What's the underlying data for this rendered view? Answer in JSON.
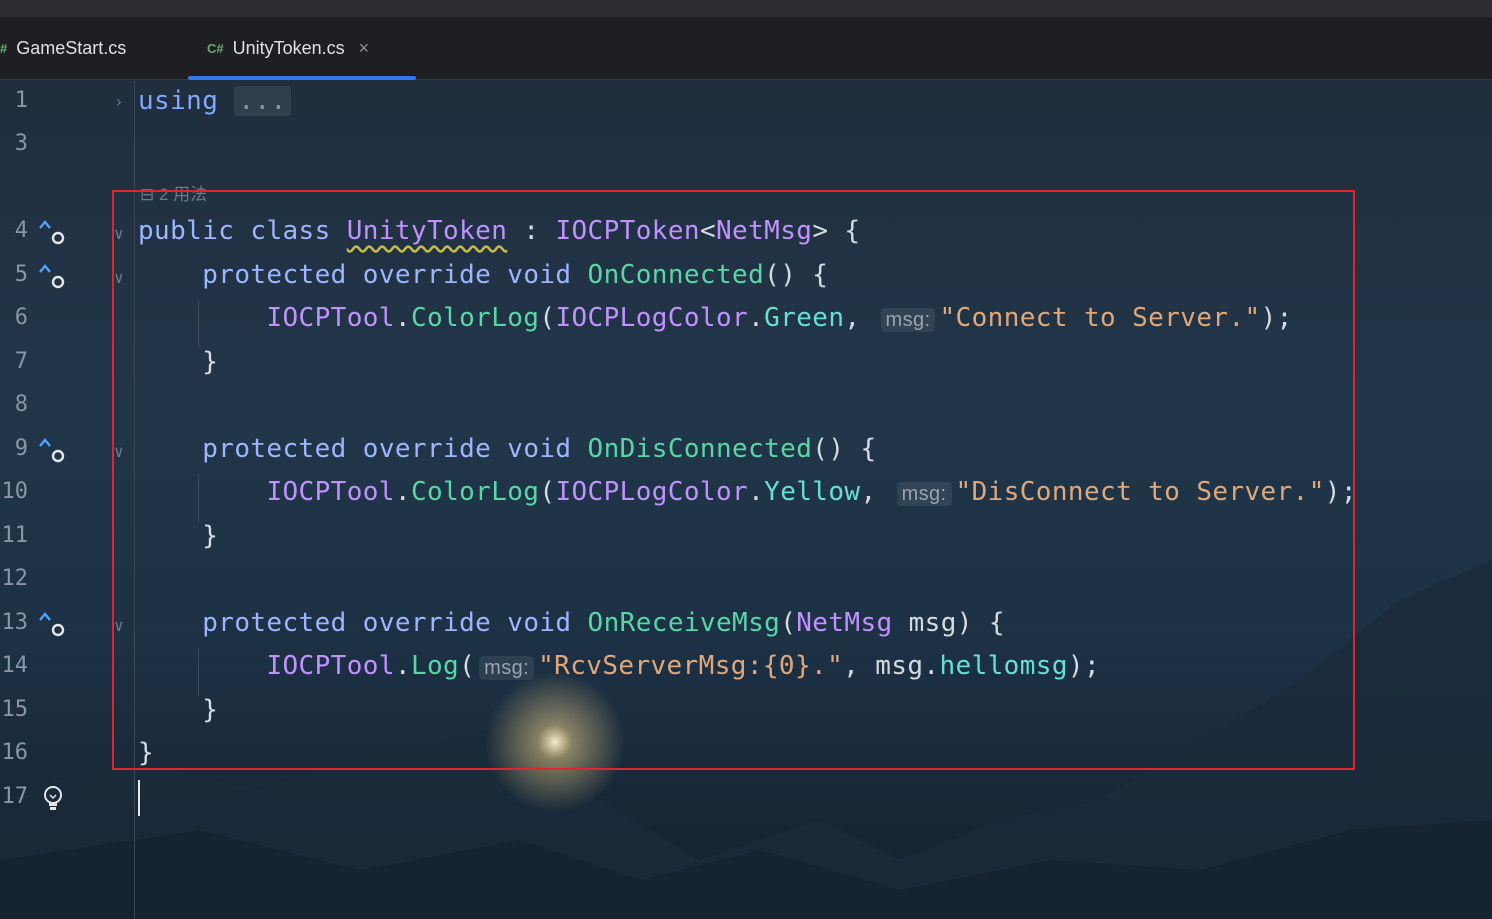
{
  "tabs": [
    {
      "icon": "#",
      "label": "GameStart.cs",
      "active": false
    },
    {
      "icon": "C#",
      "label": "UnityToken.cs",
      "active": true,
      "close": "×"
    }
  ],
  "usages": "2 用法",
  "lines": {
    "n1": "1",
    "n3": "3",
    "n4": "4",
    "n5": "5",
    "n6": "6",
    "n7": "7",
    "n8": "8",
    "n9": "9",
    "n10": "10",
    "n11": "11",
    "n12": "12",
    "n13": "13",
    "n14": "14",
    "n15": "15",
    "n16": "16",
    "n17": "17"
  },
  "code": {
    "l1_kw": "using",
    "l1_fold": "...",
    "l4_kw1": "public",
    "l4_kw2": "class",
    "l4_name": "UnityToken",
    "l4_colon": " : ",
    "l4_base": "IOCPToken",
    "l4_lt": "<",
    "l4_generic": "NetMsg",
    "l4_gt": "> {",
    "l5_kw1": "protected",
    "l5_kw2": "override",
    "l5_kw3": "void",
    "l5_fn": "OnConnected",
    "l5_tail": "() {",
    "l6_cls": "IOCPTool",
    "l6_dot": ".",
    "l6_fn": "ColorLog",
    "l6_paren": "(",
    "l6_enum": "IOCPLogColor",
    "l6_dot2": ".",
    "l6_val": "Green",
    "l6_comma": ", ",
    "l6_hint": "msg:",
    "l6_str": "\"Connect to Server.\"",
    "l6_end": ");",
    "l7": "}",
    "l9_kw1": "protected",
    "l9_kw2": "override",
    "l9_kw3": "void",
    "l9_fn": "OnDisConnected",
    "l9_tail": "() {",
    "l10_cls": "IOCPTool",
    "l10_dot": ".",
    "l10_fn": "ColorLog",
    "l10_paren": "(",
    "l10_enum": "IOCPLogColor",
    "l10_dot2": ".",
    "l10_val": "Yellow",
    "l10_comma": ", ",
    "l10_hint": "msg:",
    "l10_str": "\"DisConnect to Server.\"",
    "l10_end": ");",
    "l11": "}",
    "l13_kw1": "protected",
    "l13_kw2": "override",
    "l13_kw3": "void",
    "l13_fn": "OnReceiveMsg",
    "l13_paren": "(",
    "l13_type": "NetMsg",
    "l13_param": " msg",
    "l13_tail": ") {",
    "l14_cls": "IOCPTool",
    "l14_dot": ".",
    "l14_fn": "Log",
    "l14_paren": "(",
    "l14_hint": "msg:",
    "l14_str": "\"RcvServerMsg:{0}.\"",
    "l14_comma": ", msg.",
    "l14_prop": "hellomsg",
    "l14_end": ");",
    "l15": "}",
    "l16": "}"
  },
  "icons": {
    "override_marker": "override-up-arrow-icon",
    "bulb": "lightbulb-icon",
    "fold": "chevron-icon"
  },
  "colors": {
    "highlight_box": "#e0252f",
    "active_tab_underline": "#3574f0"
  }
}
